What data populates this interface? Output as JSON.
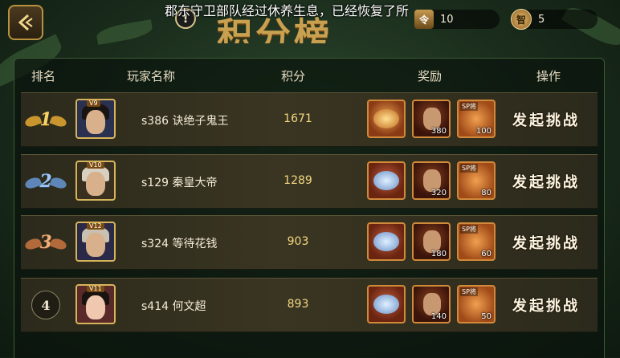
{
  "header": {
    "title": "积分榜",
    "marquee": "郡东守卫部队经过休养生息，已经恢复了所",
    "warning_symbol": "!",
    "resource_1": {
      "icon": "令",
      "value": "10"
    },
    "resource_2": {
      "icon": "智",
      "value": "5"
    }
  },
  "columns": {
    "rank": "排名",
    "player": "玩家名称",
    "score": "积分",
    "reward": "奖励",
    "action": "操作"
  },
  "rows": [
    {
      "rank": "1",
      "vip": "V9",
      "name": "s386 诀绝子鬼王",
      "score": "1671",
      "reward_hero_qty": "380",
      "reward_sp_label": "SP将",
      "reward_sp_qty": "100",
      "action": "发起挑战"
    },
    {
      "rank": "2",
      "vip": "V10",
      "name": "s129 秦皇大帝",
      "score": "1289",
      "reward_hero_qty": "320",
      "reward_sp_label": "SP将",
      "reward_sp_qty": "80",
      "action": "发起挑战"
    },
    {
      "rank": "3",
      "vip": "V12",
      "name": "s324 等待花钱",
      "score": "903",
      "reward_hero_qty": "180",
      "reward_sp_label": "SP将",
      "reward_sp_qty": "60",
      "action": "发起挑战"
    },
    {
      "rank": "4",
      "vip": "V11",
      "name": "s414 何文超",
      "score": "893",
      "reward_hero_qty": "140",
      "reward_sp_label": "SP将",
      "reward_sp_qty": "50",
      "action": "发起挑战"
    }
  ],
  "colors": {
    "gold": "#f6d46a",
    "panel_border": "#3d5a34",
    "reward_border": "#d08a3a"
  }
}
